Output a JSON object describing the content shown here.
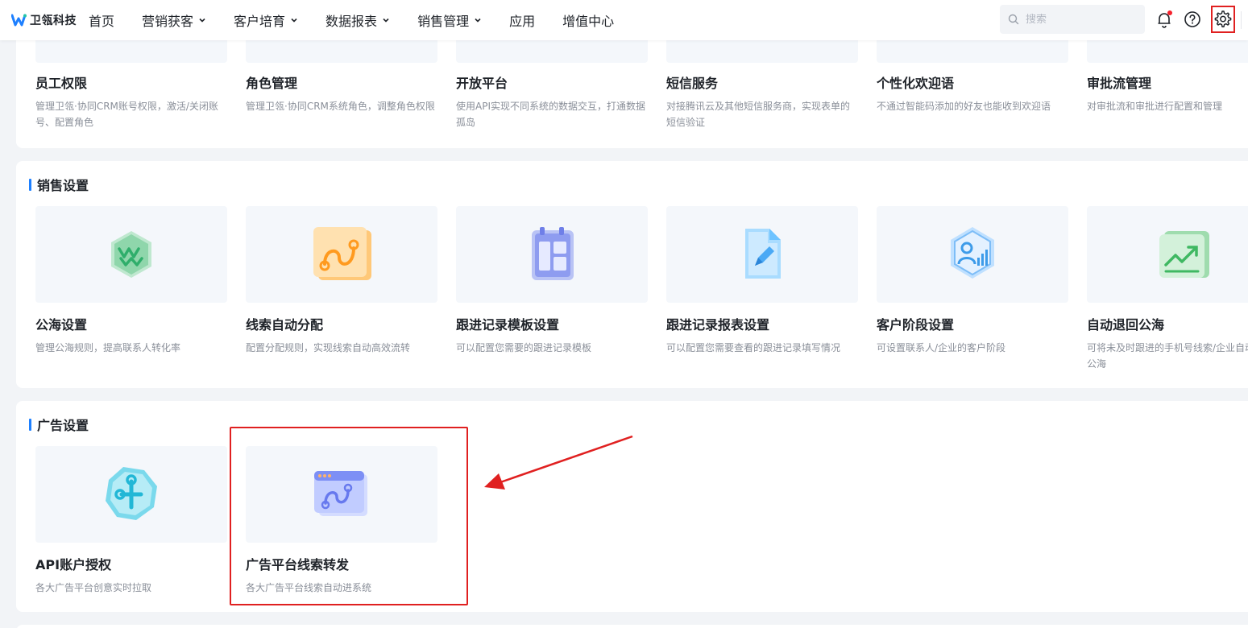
{
  "app": {
    "logo_text": "卫瓴科技"
  },
  "nav": {
    "items": [
      {
        "label": "首页",
        "has_dropdown": false
      },
      {
        "label": "营销获客",
        "has_dropdown": true
      },
      {
        "label": "客户培育",
        "has_dropdown": true
      },
      {
        "label": "数据报表",
        "has_dropdown": true
      },
      {
        "label": "销售管理",
        "has_dropdown": true
      },
      {
        "label": "应用",
        "has_dropdown": false
      },
      {
        "label": "增值中心",
        "has_dropdown": false
      }
    ]
  },
  "search": {
    "placeholder": "搜索",
    "value": ""
  },
  "top_icons": [
    "bell-icon",
    "help-icon",
    "settings-gear-icon"
  ],
  "sections": {
    "top": {
      "cards": [
        {
          "title": "员工权限",
          "desc": "管理卫瓴·协同CRM账号权限，激活/关闭账号、配置角色"
        },
        {
          "title": "角色管理",
          "desc": "管理卫瓴·协同CRM系统角色，调整角色权限"
        },
        {
          "title": "开放平台",
          "desc": "使用API实现不同系统的数据交互，打通数据孤岛"
        },
        {
          "title": "短信服务",
          "desc": "对接腾讯云及其他短信服务商，实现表单的短信验证"
        },
        {
          "title": "个性化欢迎语",
          "desc": "不通过智能码添加的好友也能收到欢迎语"
        },
        {
          "title": "审批流管理",
          "desc": "对审批流和审批进行配置和管理"
        }
      ]
    },
    "sales": {
      "title": "销售设置",
      "cards": [
        {
          "title": "公海设置",
          "desc": "管理公海规则，提高联系人转化率",
          "icon": "sea-pool-icon"
        },
        {
          "title": "线索自动分配",
          "desc": "配置分配规则，实现线索自动高效流转",
          "icon": "route-icon"
        },
        {
          "title": "跟进记录模板设置",
          "desc": "可以配置您需要的跟进记录模板",
          "icon": "template-icon"
        },
        {
          "title": "跟进记录报表设置",
          "desc": "可以配置您需要查看的跟进记录填写情况",
          "icon": "report-edit-icon"
        },
        {
          "title": "客户阶段设置",
          "desc": "可设置联系人/企业的客户阶段",
          "icon": "customer-stage-icon"
        },
        {
          "title": "自动退回公海",
          "desc": "可将未及时跟进的手机号线索/企业自动退回公海",
          "icon": "auto-return-icon"
        }
      ]
    },
    "ads": {
      "title": "广告设置",
      "cards": [
        {
          "title": "API账户授权",
          "desc": "各大广告平台创意实时拉取",
          "icon": "api-auth-icon"
        },
        {
          "title": "广告平台线索转发",
          "desc": "各大广告平台线索自动进系统",
          "icon": "lead-forward-icon"
        }
      ]
    }
  },
  "colors": {
    "accent": "#1e80ff",
    "highlight": "#e02020",
    "card_bg": "#f4f7fb"
  }
}
